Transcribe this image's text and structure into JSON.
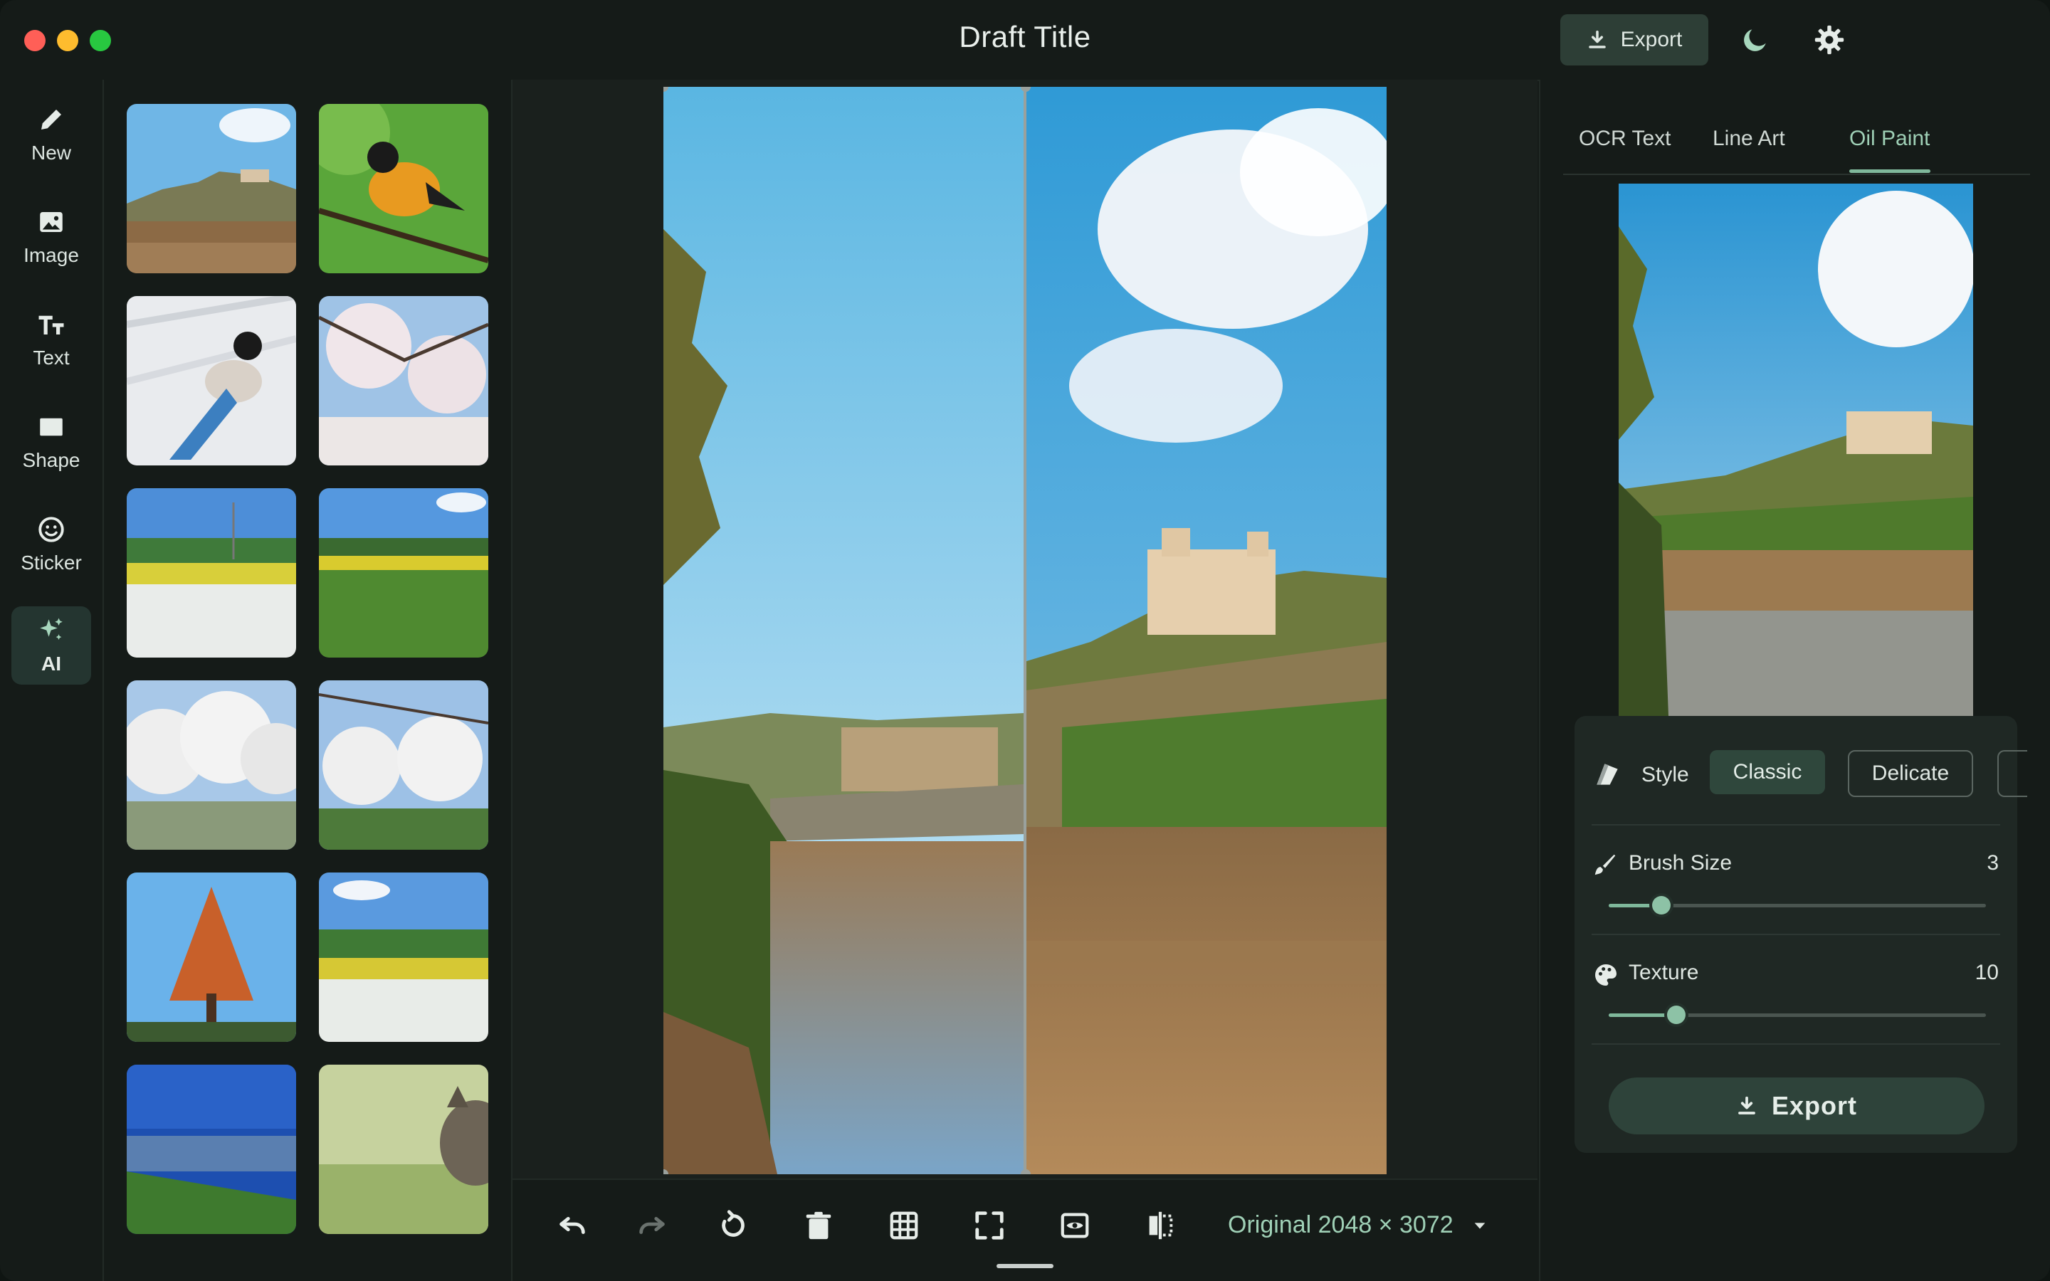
{
  "window": {
    "title": "Draft Title"
  },
  "toolbar": {
    "export_label": "Export"
  },
  "rail": {
    "items": [
      {
        "label": "New",
        "icon": "pencil-icon"
      },
      {
        "label": "Image",
        "icon": "image-icon"
      },
      {
        "label": "Text",
        "icon": "text-icon"
      },
      {
        "label": "Shape",
        "icon": "shape-icon"
      },
      {
        "label": "Sticker",
        "icon": "sticker-icon"
      },
      {
        "label": "AI",
        "icon": "sparkle-icon",
        "active": true
      }
    ]
  },
  "canvas": {
    "size_label": "Original 2048 × 3072"
  },
  "panel": {
    "tabs": [
      {
        "label": "OCR Text"
      },
      {
        "label": "Line Art"
      },
      {
        "label": "Oil Paint",
        "active": true
      }
    ],
    "style": {
      "label": "Style",
      "options": [
        "Classic",
        "Delicate"
      ],
      "selected": "Classic"
    },
    "brush": {
      "label": "Brush Size",
      "value": "3",
      "level": 0.14
    },
    "texture": {
      "label": "Texture",
      "value": "10",
      "level": 0.18
    },
    "export_label": "Export"
  },
  "colors": {
    "accent": "#7fb89b",
    "background": "#151b18",
    "panel": "#1f2824"
  }
}
